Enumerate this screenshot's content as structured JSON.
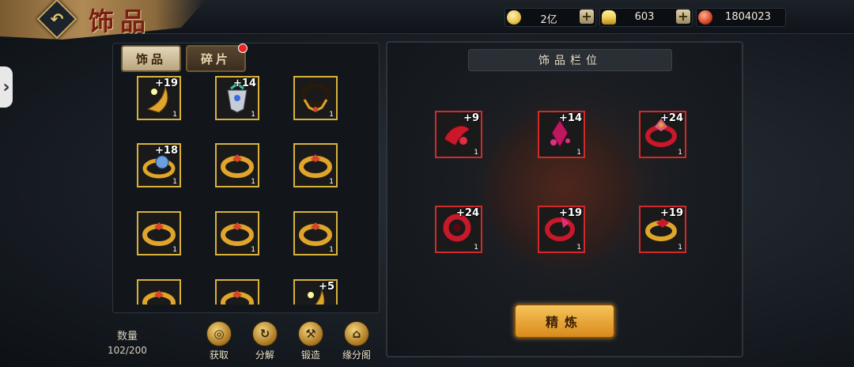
{
  "header": {
    "back_label": "↶",
    "title": "饰品"
  },
  "currencies": [
    {
      "icon": "gold-coin-icon",
      "value": "2亿",
      "color": "#e8c04a"
    },
    {
      "icon": "silver-ingot-icon",
      "value": "603",
      "color": "#f2d15a"
    },
    {
      "icon": "red-gem-icon",
      "value": "1804023",
      "color": "#d8442a"
    }
  ],
  "plus_label": "+",
  "side_arrow": "›",
  "tabs": [
    {
      "label": "饰品",
      "active": true
    },
    {
      "label": "碎片",
      "active": false,
      "badge": true
    }
  ],
  "inventory": [
    {
      "level": "+19",
      "count": "1",
      "kind": "talisman-icon"
    },
    {
      "level": "+14",
      "count": "1",
      "kind": "armor-charm-icon"
    },
    {
      "level": "",
      "count": "1",
      "kind": "necklace-icon"
    },
    {
      "level": "+18",
      "count": "1",
      "kind": "gem-ring-icon"
    },
    {
      "level": "",
      "count": "1",
      "kind": "gold-ring-icon"
    },
    {
      "level": "",
      "count": "1",
      "kind": "gold-ring-icon"
    },
    {
      "level": "",
      "count": "1",
      "kind": "gold-ring-icon"
    },
    {
      "level": "",
      "count": "1",
      "kind": "gold-ring-icon"
    },
    {
      "level": "",
      "count": "1",
      "kind": "gold-ring-icon"
    },
    {
      "level": "",
      "count": "",
      "kind": "gold-ring-icon"
    },
    {
      "level": "",
      "count": "",
      "kind": "gold-ring-icon"
    },
    {
      "level": "+5",
      "count": "",
      "kind": "talisman-icon"
    }
  ],
  "count_label": "数量",
  "count_value": "102/200",
  "actions": [
    {
      "label": "获取",
      "glyph": "◎"
    },
    {
      "label": "分解",
      "glyph": "↻"
    },
    {
      "label": "锻造",
      "glyph": "⚒"
    },
    {
      "label": "缘分阁",
      "glyph": "⌂"
    }
  ],
  "slots_title": "饰品栏位",
  "equipped": [
    {
      "level": "+9",
      "count": "1",
      "kind": "red-fan-icon"
    },
    {
      "level": "+14",
      "count": "1",
      "kind": "red-crystal-icon"
    },
    {
      "level": "+24",
      "count": "1",
      "kind": "red-crown-ring-icon"
    },
    {
      "level": "+24",
      "count": "1",
      "kind": "red-coil-icon"
    },
    {
      "level": "+19",
      "count": "1",
      "kind": "red-ring-icon"
    },
    {
      "level": "+19",
      "count": "1",
      "kind": "gold-ring-icon"
    }
  ],
  "refine_label": "精炼"
}
